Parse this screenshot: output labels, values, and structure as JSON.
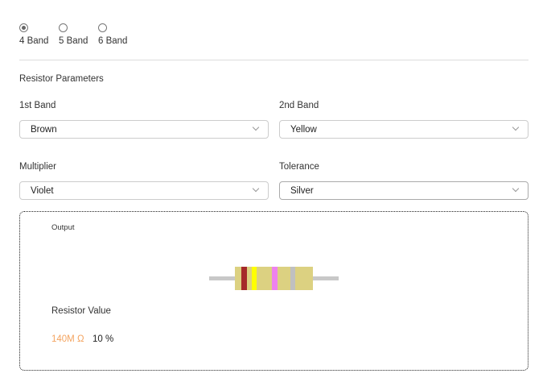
{
  "band_options": [
    {
      "label": "4 Band",
      "selected": true
    },
    {
      "label": "5 Band",
      "selected": false
    },
    {
      "label": "6 Band",
      "selected": false
    }
  ],
  "section_title": "Resistor Parameters",
  "fields": [
    {
      "label": "1st Band",
      "value": "Brown"
    },
    {
      "label": "2nd Band",
      "value": "Yellow"
    },
    {
      "label": "Multiplier",
      "value": "Violet"
    },
    {
      "label": "Tolerance",
      "value": "Silver"
    }
  ],
  "output": {
    "title": "Output",
    "value_label": "Resistor Value",
    "resistance": "140M Ω",
    "tolerance": "10 %"
  },
  "colors": {
    "body": "#dcd181",
    "lead": "#c8c8c8",
    "band1": "#a52a2a",
    "band2": "#ffff00",
    "band3": "#ee82ee",
    "band4": "#c0c0c0",
    "resistance_text": "#f4a460"
  }
}
